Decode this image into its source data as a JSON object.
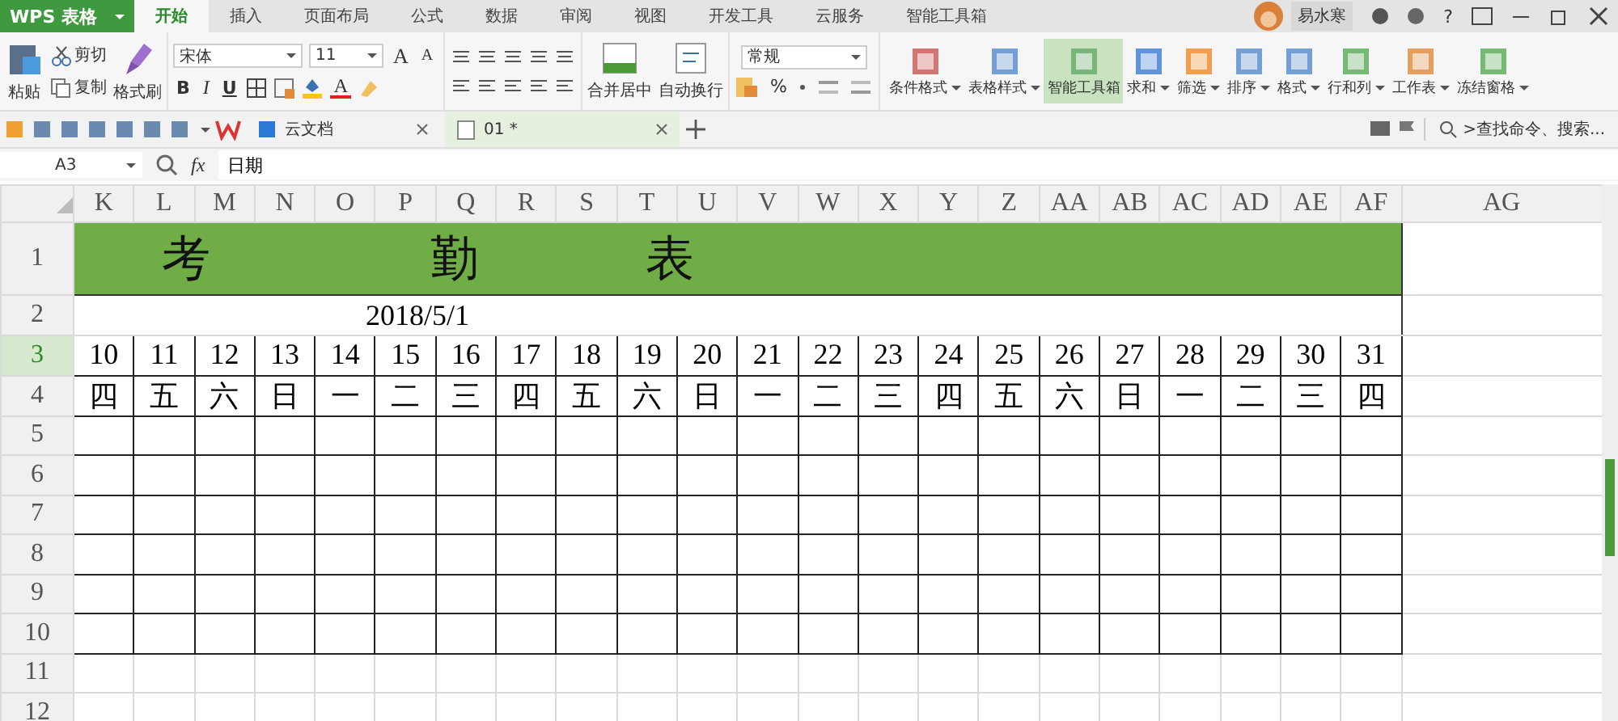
{
  "app": {
    "logo": "WPS 表格"
  },
  "tabs": [
    {
      "label": "开始",
      "selected": true
    },
    {
      "label": "插入",
      "selected": false
    },
    {
      "label": "页面布局",
      "selected": false
    },
    {
      "label": "公式",
      "selected": false
    },
    {
      "label": "数据",
      "selected": false
    },
    {
      "label": "审阅",
      "selected": false
    },
    {
      "label": "视图",
      "selected": false
    },
    {
      "label": "开发工具",
      "selected": false
    },
    {
      "label": "云服务",
      "selected": false
    },
    {
      "label": "智能工具箱",
      "selected": false
    }
  ],
  "user": {
    "name": "易水寒"
  },
  "help": "?",
  "ribbon": {
    "clipboard": {
      "paste": "粘贴",
      "cut": "剪切",
      "copy": "复制",
      "format_painter": "格式刷"
    },
    "font": {
      "name": "宋体",
      "size": "11",
      "grow": "A",
      "shrink": "A",
      "bold": "B",
      "italic": "I",
      "underline": "U",
      "font_color": "A"
    },
    "merge": "合并居中",
    "wrap": "自动换行",
    "number": {
      "format": "常规",
      "percent": "%"
    },
    "tools": [
      {
        "label": "条件格式",
        "dropdown": true,
        "selected": false
      },
      {
        "label": "表格样式",
        "dropdown": true,
        "selected": false
      },
      {
        "label": "智能工具箱",
        "dropdown": false,
        "selected": true
      },
      {
        "label": "求和",
        "dropdown": true,
        "selected": false
      },
      {
        "label": "筛选",
        "dropdown": true,
        "selected": false
      },
      {
        "label": "排序",
        "dropdown": true,
        "selected": false
      },
      {
        "label": "格式",
        "dropdown": true,
        "selected": false
      },
      {
        "label": "行和列",
        "dropdown": true,
        "selected": false
      },
      {
        "label": "工作表",
        "dropdown": true,
        "selected": false
      },
      {
        "label": "冻结窗格",
        "dropdown": true,
        "selected": false
      }
    ]
  },
  "doc_tabs": [
    {
      "label": "云文档",
      "selected": false
    },
    {
      "label": "01 *",
      "selected": true
    }
  ],
  "search": {
    "placeholder": ">查找命令、搜索..."
  },
  "formula_bar": {
    "cell": "A3",
    "fx": "fx",
    "value": "日期"
  },
  "sheet": {
    "columns": [
      "K",
      "L",
      "M",
      "N",
      "O",
      "P",
      "Q",
      "R",
      "S",
      "T",
      "U",
      "V",
      "W",
      "X",
      "Y",
      "Z",
      "AA",
      "AB",
      "AC",
      "AD",
      "AE",
      "AF"
    ],
    "extra_column": "AG",
    "title": [
      "考",
      "勤",
      "表"
    ],
    "date": "2018/5/1",
    "days": [
      "10",
      "11",
      "12",
      "13",
      "14",
      "15",
      "16",
      "17",
      "18",
      "19",
      "20",
      "21",
      "22",
      "23",
      "24",
      "25",
      "26",
      "27",
      "28",
      "29",
      "30",
      "31"
    ],
    "weekdays": [
      "四",
      "五",
      "六",
      "日",
      "一",
      "二",
      "三",
      "四",
      "五",
      "六",
      "日",
      "一",
      "二",
      "三",
      "四",
      "五",
      "六",
      "日",
      "一",
      "二",
      "三",
      "四"
    ],
    "rows": [
      {
        "label": "1",
        "kind": "title",
        "selected": false
      },
      {
        "label": "2",
        "kind": "date",
        "selected": false
      },
      {
        "label": "3",
        "kind": "days",
        "selected": true
      },
      {
        "label": "4",
        "kind": "weekdays",
        "selected": false
      },
      {
        "label": "5",
        "kind": "blank",
        "selected": false
      },
      {
        "label": "6",
        "kind": "blank",
        "selected": false
      },
      {
        "label": "7",
        "kind": "blank",
        "selected": false
      },
      {
        "label": "8",
        "kind": "blank",
        "selected": false
      },
      {
        "label": "9",
        "kind": "blank",
        "selected": false
      },
      {
        "label": "10",
        "kind": "blank",
        "selected": false
      },
      {
        "label": "11",
        "kind": "empty",
        "selected": false
      },
      {
        "label": "12",
        "kind": "empty",
        "selected": false
      }
    ]
  }
}
